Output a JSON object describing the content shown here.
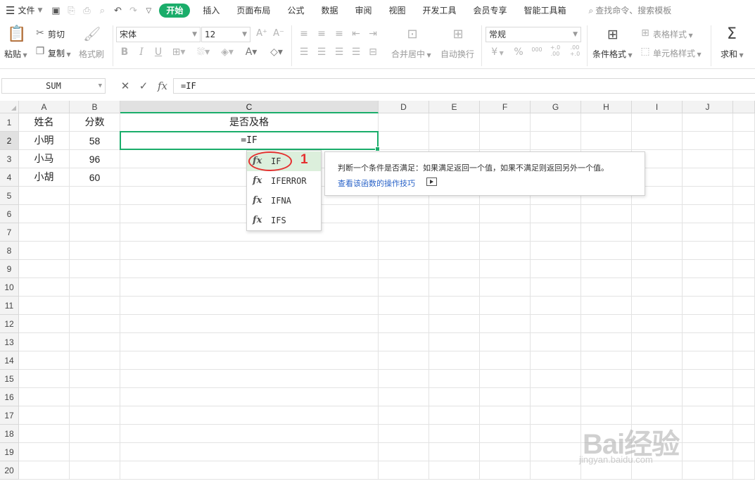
{
  "menubar": {
    "file": "文件",
    "tabs": [
      {
        "label": "开始",
        "active": true
      },
      {
        "label": "插入"
      },
      {
        "label": "页面布局"
      },
      {
        "label": "公式"
      },
      {
        "label": "数据"
      },
      {
        "label": "审阅"
      },
      {
        "label": "视图"
      },
      {
        "label": "开发工具"
      },
      {
        "label": "会员专享"
      },
      {
        "label": "智能工具箱"
      }
    ],
    "search": "查找命令、搜索模板"
  },
  "ribbon": {
    "paste": "粘贴",
    "cut": "剪切",
    "copy": "复制",
    "format_painter": "格式刷",
    "font_name": "宋体",
    "font_size": "12",
    "merge_center": "合并居中",
    "wrap_text": "自动换行",
    "number_format": "常规",
    "conditional_format": "条件格式",
    "table_style": "表格样式",
    "cell_style": "单元格样式",
    "sum": "求和",
    "currency": "¥",
    "percent": "%",
    "thousands": "000",
    "inc_decimal": "+.0 .00",
    "dec_decimal": ".00 +.0"
  },
  "formula_bar": {
    "name_box": "SUM",
    "cancel": "✕",
    "enter": "✓",
    "fx": "fx",
    "formula": "=IF"
  },
  "sheet": {
    "columns": [
      "A",
      "B",
      "C",
      "D",
      "E",
      "F",
      "G",
      "H",
      "I",
      "J"
    ],
    "rows": [
      "1",
      "2",
      "3",
      "4",
      "5",
      "6",
      "7",
      "8",
      "9",
      "10",
      "11",
      "12",
      "13",
      "14",
      "15",
      "16",
      "17",
      "18",
      "19",
      "20"
    ],
    "selected_column": "C",
    "selected_row": "2",
    "cells": {
      "A1": "姓名",
      "B1": "分数",
      "C1": "是否及格",
      "A2": "小明",
      "B2": "58",
      "C2": "=IF",
      "A3": "小马",
      "B3": "96",
      "A4": "小胡",
      "B4": "60"
    }
  },
  "autocomplete": {
    "items": [
      "IF",
      "IFERROR",
      "IFNA",
      "IFS"
    ],
    "selected": "IF",
    "step_marker": "1"
  },
  "tooltip": {
    "description": "判断一个条件是否满足：如果满足返回一个值，如果不满足则返回另外一个值。",
    "link": "查看该函数的操作技巧"
  },
  "watermark": {
    "brand": "Bai经验",
    "url": "jingyan.baidu.com"
  },
  "colors": {
    "accent": "#1aad6a",
    "annotation": "#e53030",
    "link": "#2a63c8"
  }
}
